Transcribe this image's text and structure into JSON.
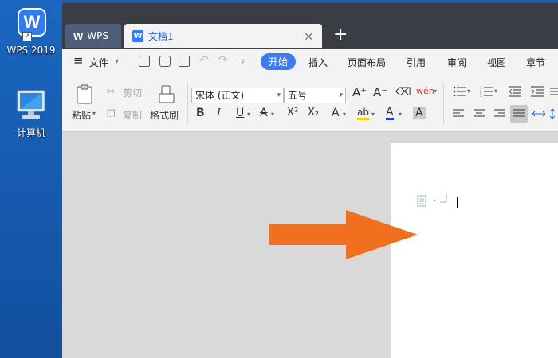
{
  "desktop": {
    "wps_icon_label": "WPS 2019",
    "wps_logo_letter": "W",
    "computer_icon_label": "计算机"
  },
  "tabs": {
    "wps_label": "WPS",
    "doc_label": "文档1",
    "doc_glyph": "W",
    "close_glyph": "×",
    "add_glyph": "+"
  },
  "menu": {
    "hamburger": "≡",
    "file": "文件",
    "items": [
      "开始",
      "插入",
      "页面布局",
      "引用",
      "审阅",
      "视图",
      "章节"
    ]
  },
  "ribbon": {
    "paste": "粘贴",
    "cut": "剪切",
    "copy": "复制",
    "format_painter": "格式刷",
    "font_name": "宋体 (正文)",
    "font_size": "五号",
    "bold": "B",
    "italic": "I",
    "underline": "U",
    "strike": "A",
    "superscript": "X²",
    "subscript": "X₂",
    "text_effect": "A",
    "font_color": "A",
    "char_shading": "A",
    "grow_font": "A⁺",
    "shrink_font": "A⁻",
    "pinyin": "wén"
  },
  "colors": {
    "accent": "#3c7cf0",
    "arrow": "#f07020",
    "titlebar": "#3a3d43",
    "desktop": "#1559ad"
  }
}
